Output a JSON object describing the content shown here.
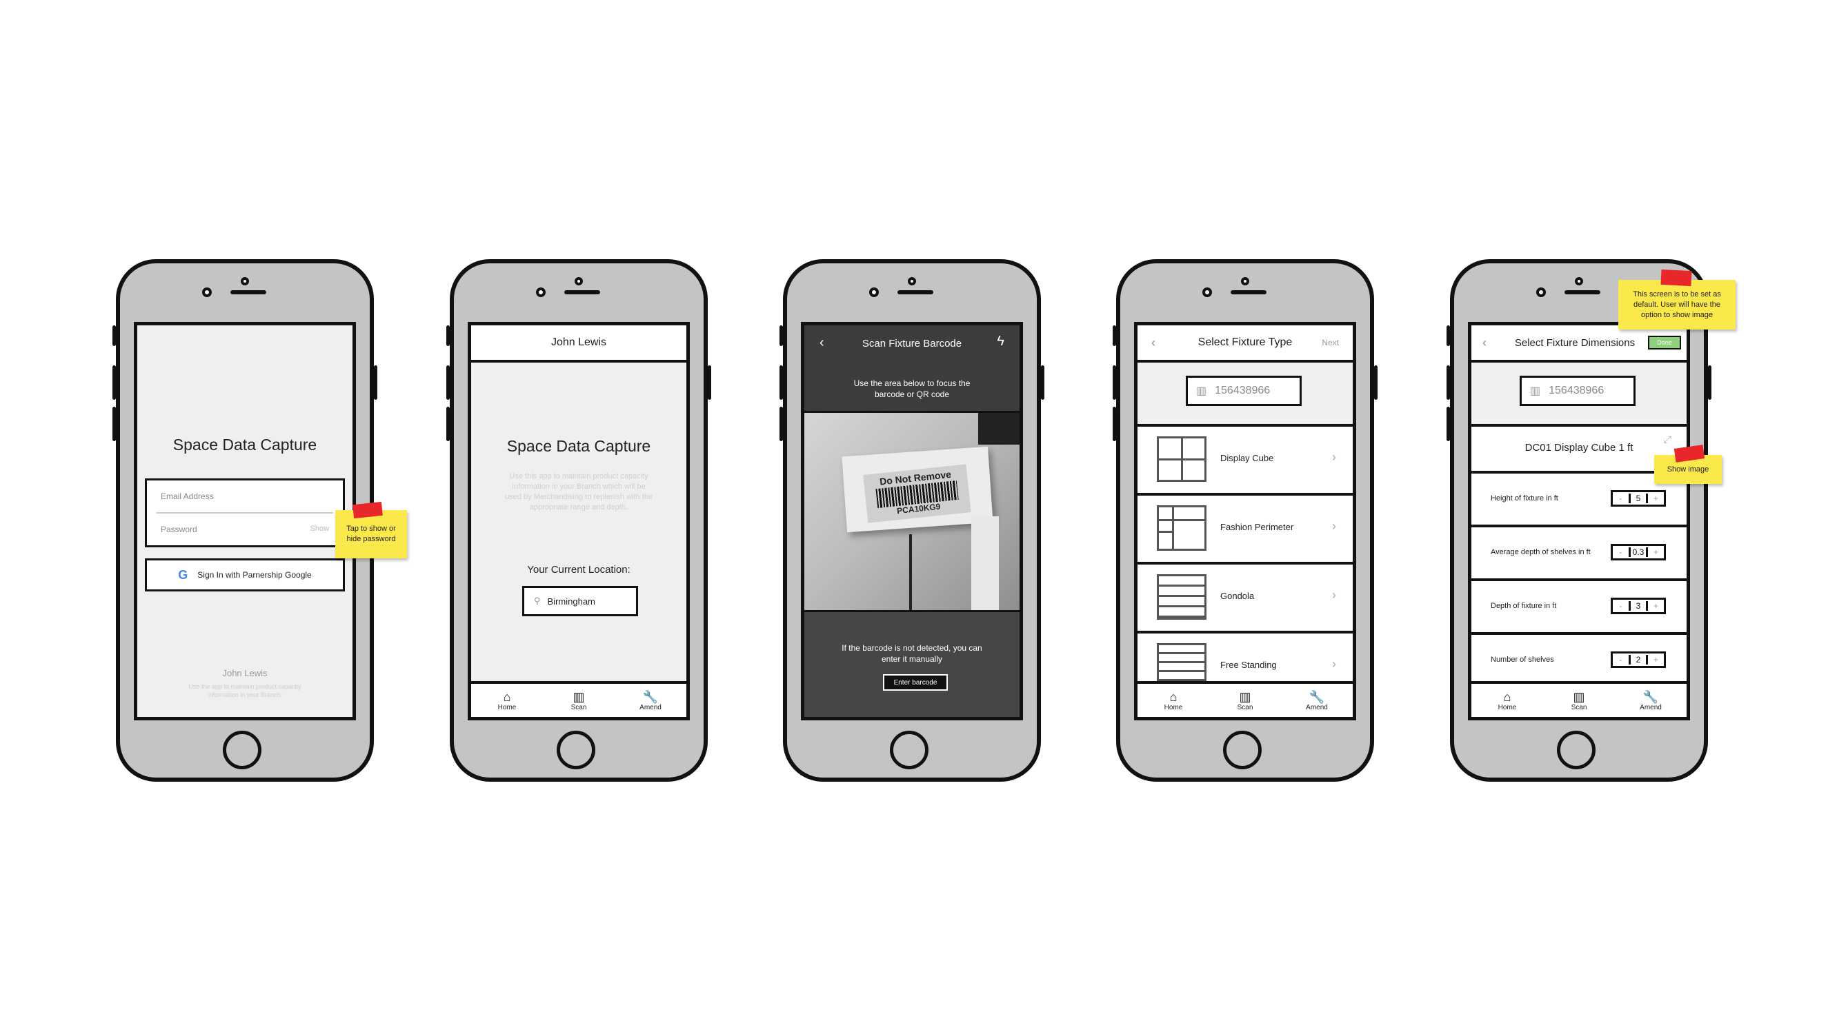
{
  "screen1": {
    "title": "Space Data Capture",
    "email_placeholder": "Email Address",
    "password_placeholder": "Password",
    "show_toggle": "Show",
    "google_button": "Sign In with Parnership Google",
    "footer_title": "John Lewis",
    "footer_text": "Use the app to maintain product capacity information in your Branch.",
    "sticky_note": "Tap to show or hide password"
  },
  "screen2": {
    "header": "John Lewis",
    "title": "Space Data Capture",
    "description": "Use this app to maintain product capacity information in your Branch which will be used by Merchandising to replenish with the appropriate range and depth.",
    "location_label": "Your Current Location:",
    "location_value": "Birmingham"
  },
  "screen3": {
    "header": "Scan Fixture Barcode",
    "instruction": "Use the area below to focus the barcode or QR code",
    "sticker_text": "Do Not Remove",
    "sticker_code": "PCA10KG9",
    "manual_text": "If the barcode is not detected, you can enter it manually",
    "enter_button": "Enter barcode"
  },
  "screen4": {
    "header": "Select Fixture Type",
    "next": "Next",
    "barcode": "156438966",
    "fixtures": [
      "Display Cube",
      "Fashion Perimeter",
      "Gondola",
      "Free Standing"
    ]
  },
  "screen5": {
    "header": "Select Fixture Dimensions",
    "done": "Done",
    "barcode": "156438966",
    "fixture_name": "DC01 Display Cube 1 ft",
    "rows": [
      {
        "label": "Height of fixture in ft",
        "value": "5"
      },
      {
        "label": "Average depth of shelves in ft",
        "value": "0.3"
      },
      {
        "label": "Depth of fixture in ft",
        "value": "3"
      },
      {
        "label": "Number of shelves",
        "value": "2"
      }
    ],
    "sticky_default": "This screen is to be set as default. User will have the option to show image",
    "sticky_show_image": "Show image"
  },
  "tabs": {
    "home": "Home",
    "scan": "Scan",
    "amend": "Amend"
  },
  "stepper": {
    "minus": "-",
    "plus": "+"
  },
  "colors": {
    "sticky": "#fbe84a",
    "tape": "#e8272a",
    "done": "#8fd17a",
    "phone_body": "#c4c4c4"
  }
}
